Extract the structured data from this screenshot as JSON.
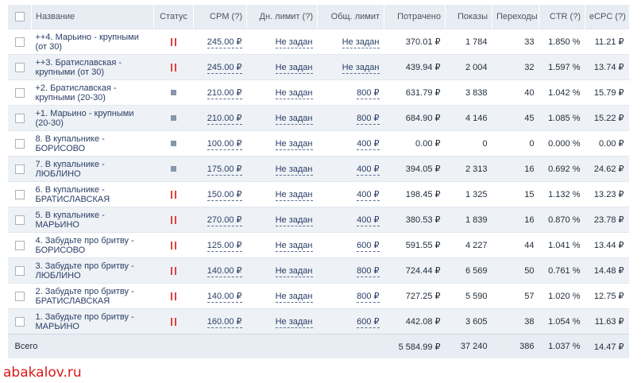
{
  "header": {
    "name": "Название",
    "status": "Статус",
    "cpm": "CPM (?)",
    "daily_limit": "Дн. лимит (?)",
    "total_limit": "Общ. лимит",
    "spent": "Потрачено",
    "impressions": "Показы",
    "clicks": "Переходы",
    "ctr": "CTR (?)",
    "ecpc": "eCPC (?)"
  },
  "rows": [
    {
      "name": "++4. Марьино - крупными (от 30)",
      "status": "paused",
      "cpm": "245.00 ₽",
      "daily": "Не задан",
      "total": "Не задан",
      "spent": "370.01 ₽",
      "impressions": "1 784",
      "clicks": "33",
      "ctr": "1.850 %",
      "ecpc": "11.21 ₽"
    },
    {
      "name": "++3. Братиславская - крупными (от 30)",
      "status": "paused",
      "cpm": "245.00 ₽",
      "daily": "Не задан",
      "total": "Не задан",
      "spent": "439.94 ₽",
      "impressions": "2 004",
      "clicks": "32",
      "ctr": "1.597 %",
      "ecpc": "13.74 ₽"
    },
    {
      "name": "+2. Братиславская - крупными (20-30)",
      "status": "stopped",
      "cpm": "210.00 ₽",
      "daily": "Не задан",
      "total": "800 ₽",
      "spent": "631.79 ₽",
      "impressions": "3 838",
      "clicks": "40",
      "ctr": "1.042 %",
      "ecpc": "15.79 ₽"
    },
    {
      "name": "+1. Марьино - крупными (20-30)",
      "status": "stopped",
      "cpm": "210.00 ₽",
      "daily": "Не задан",
      "total": "800 ₽",
      "spent": "684.90 ₽",
      "impressions": "4 146",
      "clicks": "45",
      "ctr": "1.085 %",
      "ecpc": "15.22 ₽"
    },
    {
      "name": "8. В купальнике - БОРИСОВО",
      "status": "stopped",
      "cpm": "100.00 ₽",
      "daily": "Не задан",
      "total": "400 ₽",
      "spent": "0.00 ₽",
      "impressions": "0",
      "clicks": "0",
      "ctr": "0.000 %",
      "ecpc": "0.00 ₽"
    },
    {
      "name": "7. В купальнике - ЛЮБЛИНО",
      "status": "stopped",
      "cpm": "175.00 ₽",
      "daily": "Не задан",
      "total": "400 ₽",
      "spent": "394.05 ₽",
      "impressions": "2 313",
      "clicks": "16",
      "ctr": "0.692 %",
      "ecpc": "24.62 ₽"
    },
    {
      "name": "6. В купальнике - БРАТИСЛАВСКАЯ",
      "status": "paused",
      "cpm": "150.00 ₽",
      "daily": "Не задан",
      "total": "400 ₽",
      "spent": "198.45 ₽",
      "impressions": "1 325",
      "clicks": "15",
      "ctr": "1.132 %",
      "ecpc": "13.23 ₽"
    },
    {
      "name": "5. В купальнике - МАРЬИНО",
      "status": "paused",
      "cpm": "270.00 ₽",
      "daily": "Не задан",
      "total": "400 ₽",
      "spent": "380.53 ₽",
      "impressions": "1 839",
      "clicks": "16",
      "ctr": "0.870 %",
      "ecpc": "23.78 ₽"
    },
    {
      "name": "4. Забудьте про бритву - БОРИСОВО",
      "status": "paused",
      "cpm": "125.00 ₽",
      "daily": "Не задан",
      "total": "600 ₽",
      "spent": "591.55 ₽",
      "impressions": "4 227",
      "clicks": "44",
      "ctr": "1.041 %",
      "ecpc": "13.44 ₽"
    },
    {
      "name": "3. Забудьте про бритву - ЛЮБЛИНО",
      "status": "paused",
      "cpm": "140.00 ₽",
      "daily": "Не задан",
      "total": "800 ₽",
      "spent": "724.44 ₽",
      "impressions": "6 569",
      "clicks": "50",
      "ctr": "0.761 %",
      "ecpc": "14.48 ₽"
    },
    {
      "name": "2. Забудьте про бритву - БРАТИСЛАВСКАЯ",
      "status": "paused",
      "cpm": "140.00 ₽",
      "daily": "Не задан",
      "total": "800 ₽",
      "spent": "727.25 ₽",
      "impressions": "5 590",
      "clicks": "57",
      "ctr": "1.020 %",
      "ecpc": "12.75 ₽"
    },
    {
      "name": "1. Забудьте про бритву - МАРЬИНО",
      "status": "paused",
      "cpm": "160.00 ₽",
      "daily": "Не задан",
      "total": "600 ₽",
      "spent": "442.08 ₽",
      "impressions": "3 605",
      "clicks": "38",
      "ctr": "1.054 %",
      "ecpc": "11.63 ₽"
    }
  ],
  "totals": {
    "label": "Всего",
    "spent": "5 584.99 ₽",
    "impressions": "37 240",
    "clicks": "386",
    "ctr": "1.037 %",
    "ecpc": "14.47 ₽"
  },
  "watermark": "abakalov.ru",
  "colors": {
    "paused": "#e04040",
    "stopped": "#8796a8",
    "header_bg": "#e8edf3"
  },
  "icons": {
    "paused": "pause-icon",
    "stopped": "stop-icon"
  }
}
